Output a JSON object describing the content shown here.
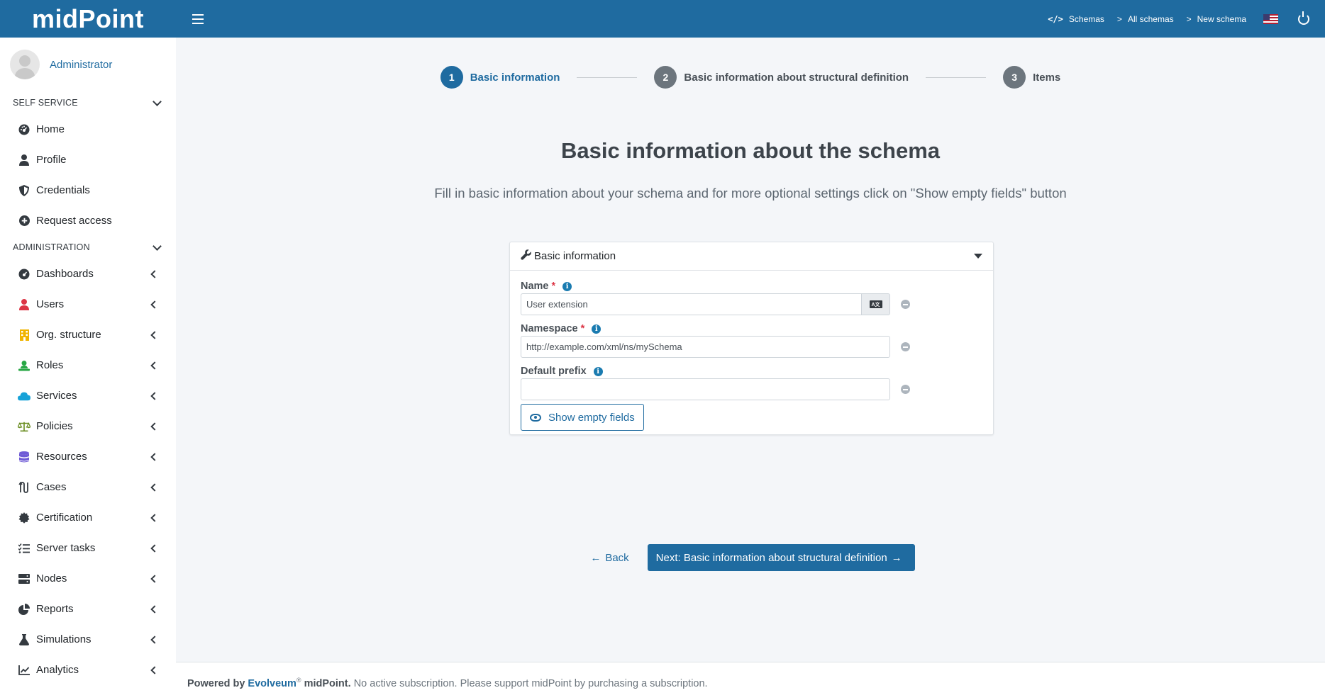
{
  "app": {
    "logo": "midPoint"
  },
  "header": {
    "breadcrumbs": [
      "Schemas",
      "All schemas",
      "New schema"
    ],
    "crumb_sep": ">",
    "code_icon": "</>"
  },
  "sidebar": {
    "user": "Administrator",
    "sections": [
      {
        "label": "SELF SERVICE"
      },
      {
        "label": "ADMINISTRATION"
      }
    ],
    "self_service": [
      {
        "label": "Home",
        "icon": "dashboard-icon"
      },
      {
        "label": "Profile",
        "icon": "user-icon"
      },
      {
        "label": "Credentials",
        "icon": "shield-icon"
      },
      {
        "label": "Request access",
        "icon": "plus-circle-icon"
      }
    ],
    "admin": [
      {
        "label": "Dashboards",
        "icon": "dashboard-icon"
      },
      {
        "label": "Users",
        "icon": "user-icon"
      },
      {
        "label": "Org. structure",
        "icon": "building-icon"
      },
      {
        "label": "Roles",
        "icon": "role-icon"
      },
      {
        "label": "Services",
        "icon": "cloud-icon"
      },
      {
        "label": "Policies",
        "icon": "scale-icon"
      },
      {
        "label": "Resources",
        "icon": "database-icon"
      },
      {
        "label": "Cases",
        "icon": "cases-icon"
      },
      {
        "label": "Certification",
        "icon": "certificate-icon"
      },
      {
        "label": "Server tasks",
        "icon": "tasks-icon"
      },
      {
        "label": "Nodes",
        "icon": "server-icon"
      },
      {
        "label": "Reports",
        "icon": "pie-chart-icon"
      },
      {
        "label": "Simulations",
        "icon": "flask-icon"
      },
      {
        "label": "Analytics",
        "icon": "chart-line-icon"
      }
    ]
  },
  "wizard": {
    "steps": [
      {
        "num": "1",
        "label": "Basic information"
      },
      {
        "num": "2",
        "label": "Basic information about structural definition"
      },
      {
        "num": "3",
        "label": "Items"
      }
    ]
  },
  "main": {
    "title": "Basic information about the schema",
    "subtitle": "Fill in basic information about your schema and for more optional settings click on \"Show empty fields\" button"
  },
  "panel": {
    "title": "Basic information",
    "fields": {
      "name": {
        "label": "Name",
        "value": "User extension"
      },
      "namespace": {
        "label": "Namespace",
        "value": "http://example.com/xml/ns/mySchema"
      },
      "prefix": {
        "label": "Default prefix",
        "value": ""
      }
    },
    "show_empty": "Show empty fields"
  },
  "actions": {
    "back": "Back",
    "next": "Next: Basic information about structural definition"
  },
  "footer": {
    "powered": "Powered by",
    "company": "Evolveum",
    "reg": "®",
    "product": "midPoint.",
    "notice": "No active subscription. Please support midPoint by purchasing a subscription."
  },
  "colors": {
    "brand": "#1f6ba0",
    "required": "#dc3545"
  }
}
